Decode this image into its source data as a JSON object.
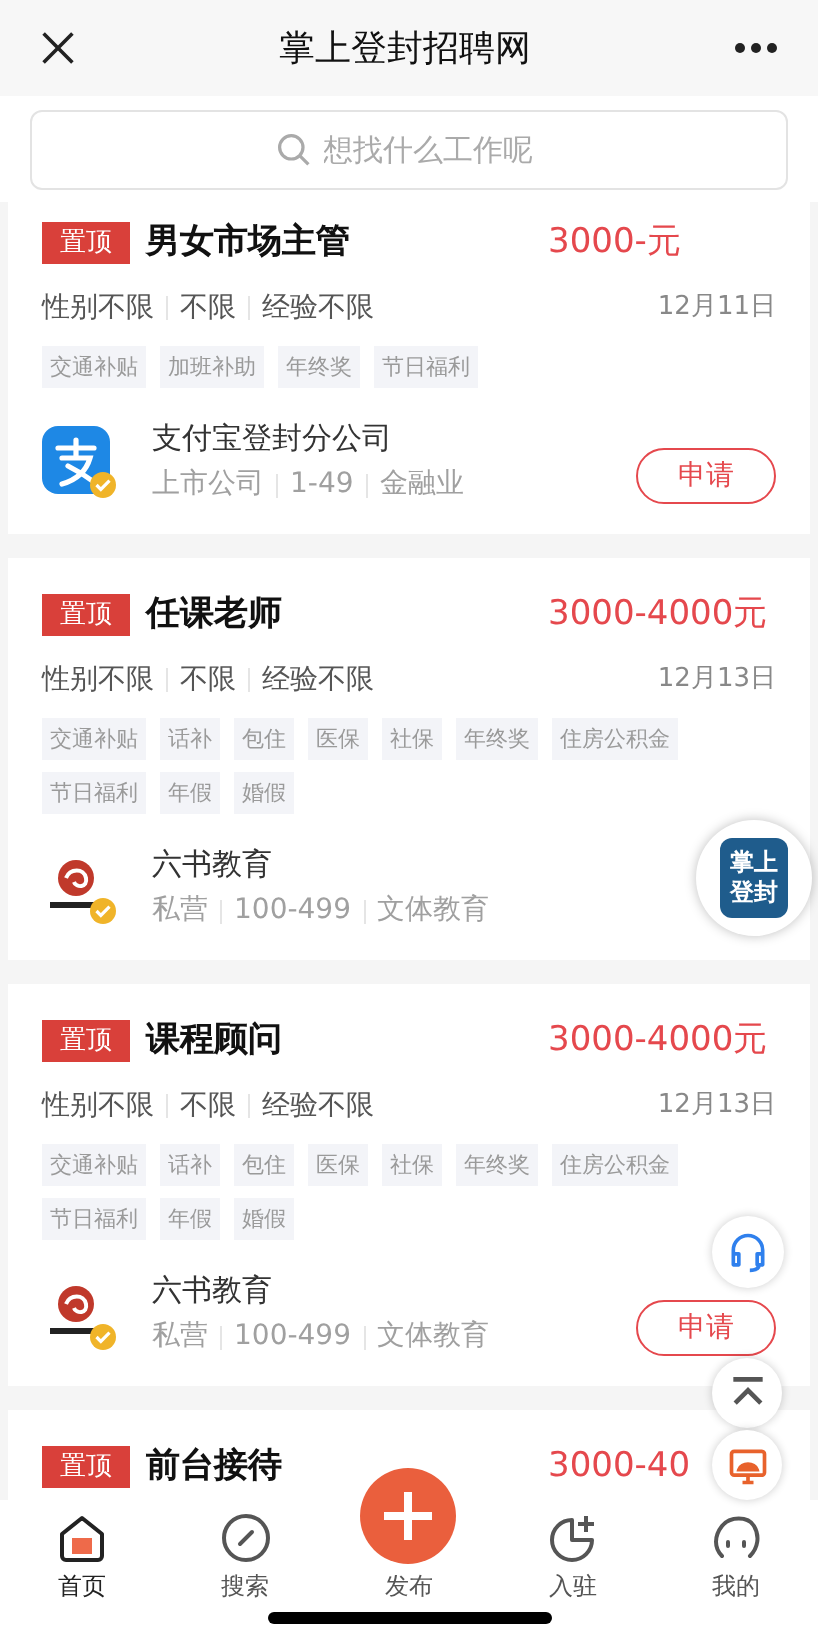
{
  "header": {
    "title": "掌上登封",
    "title_rest": "招聘网"
  },
  "search": {
    "placeholder": "想找什么工作呢"
  },
  "jobs": [
    {
      "badge": "置顶",
      "title": "男女市场主管",
      "salary": "3000-元",
      "attrs": [
        "性别不限",
        "不限",
        "经验不限"
      ],
      "date": "12月11日",
      "tags": [
        "交通补贴",
        "加班补助",
        "年终奖",
        "节日福利"
      ],
      "company": {
        "kind": "alipay",
        "name": "支付宝登封分公司",
        "meta": [
          "上市公司",
          "1-49",
          "金融业"
        ],
        "verified": true
      },
      "apply": "申请"
    },
    {
      "badge": "置顶",
      "title": "任课老师",
      "salary": "3000-4000元",
      "attrs": [
        "性别不限",
        "不限",
        "经验不限"
      ],
      "date": "12月13日",
      "tags": [
        "交通补贴",
        "话补",
        "包住",
        "医保",
        "社保",
        "年终奖",
        "住房公积金",
        "节日福利",
        "年假",
        "婚假"
      ],
      "company": {
        "kind": "bird",
        "name": "六书教育",
        "meta": [
          "私营",
          "100-499",
          "文体教育"
        ],
        "verified": true
      }
    },
    {
      "badge": "置顶",
      "title": "课程顾问",
      "salary": "3000-4000元",
      "attrs": [
        "性别不限",
        "不限",
        "经验不限"
      ],
      "date": "12月13日",
      "tags": [
        "交通补贴",
        "话补",
        "包住",
        "医保",
        "社保",
        "年终奖",
        "住房公积金",
        "节日福利",
        "年假",
        "婚假"
      ],
      "company": {
        "kind": "bird",
        "name": "六书教育",
        "meta": [
          "私营",
          "100-499",
          "文体教育"
        ],
        "verified": true
      },
      "apply": "申请"
    },
    {
      "badge": "置顶",
      "title": "前台接待",
      "salary": "3000-40"
    }
  ],
  "float_logo": {
    "line1": "掌上",
    "line2": "登封"
  },
  "nav": [
    {
      "kind": "home",
      "label": "首页",
      "selected": true
    },
    {
      "kind": "compass",
      "label": "搜索",
      "selected": false
    },
    {
      "kind": "publish",
      "label": "发布",
      "selected": false
    },
    {
      "kind": "join",
      "label": "入驻",
      "selected": false
    },
    {
      "kind": "me",
      "label": "我的",
      "selected": false
    }
  ]
}
